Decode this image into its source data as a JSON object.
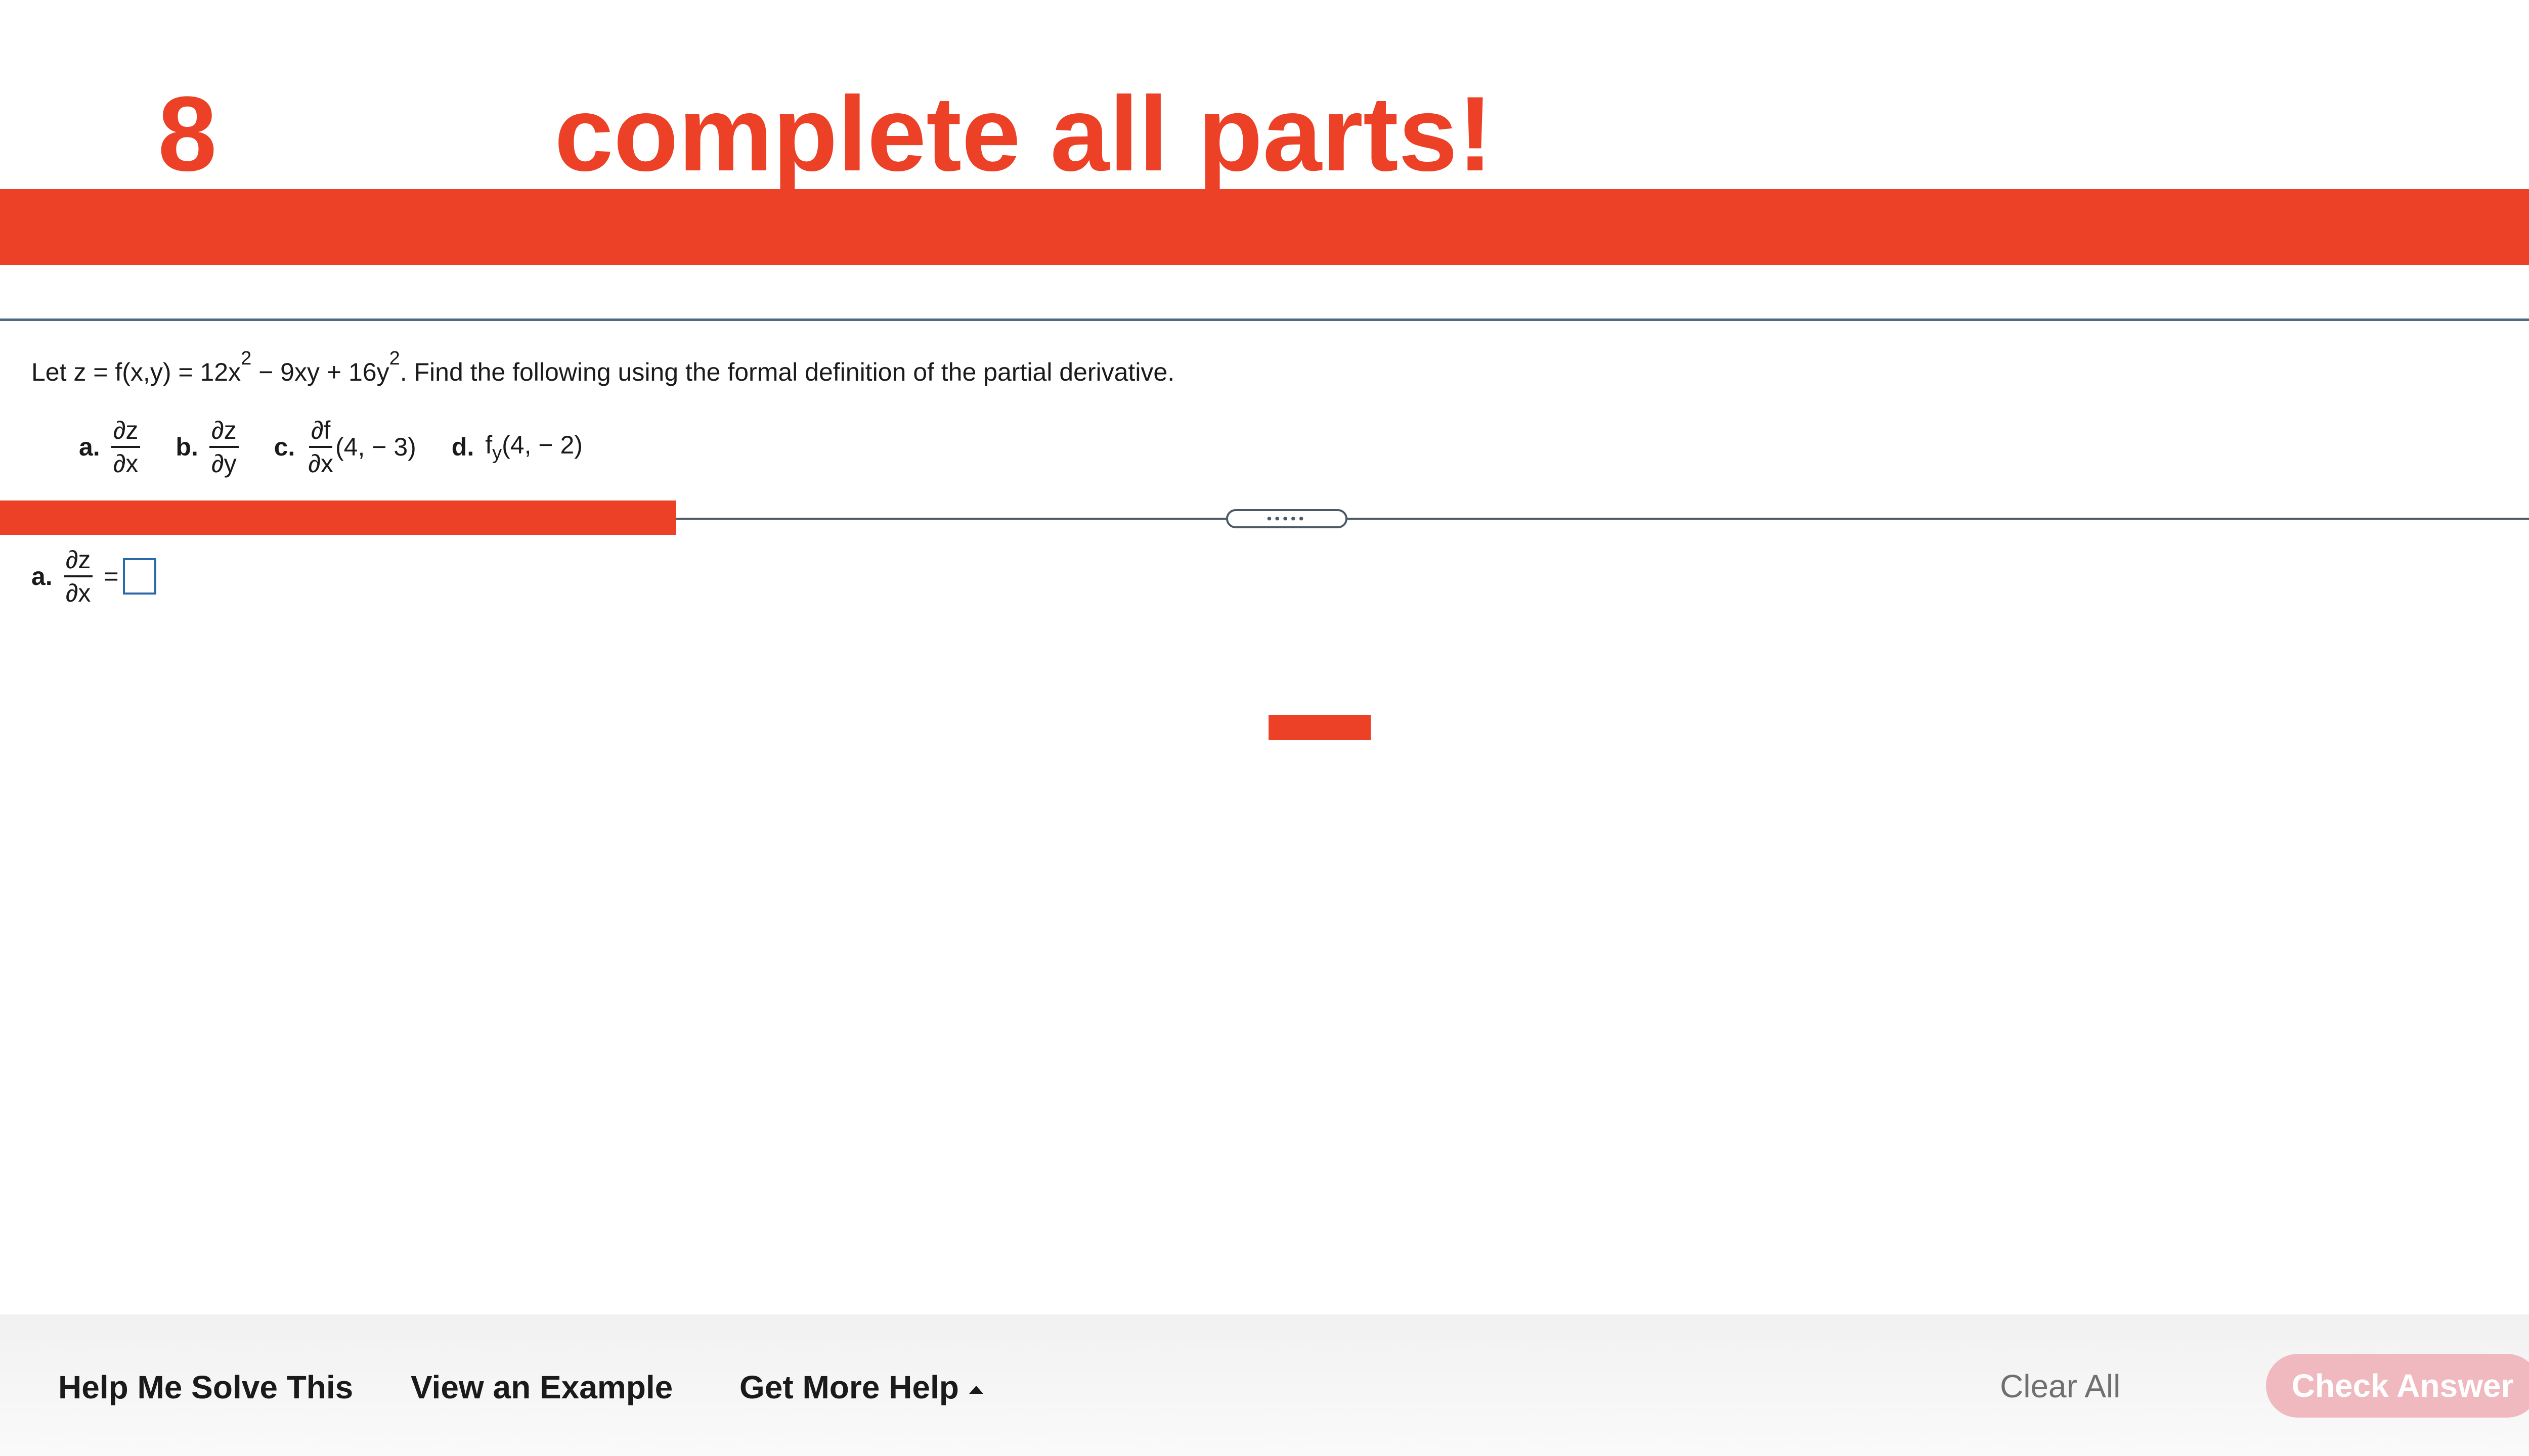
{
  "header": {
    "number": "8",
    "headline": "complete all parts!"
  },
  "question": {
    "intro_prefix": "Let z = f(x,y) = 12x",
    "exp1": "2",
    "mid": " − 9xy + 16y",
    "exp2": "2",
    "suffix": ". Find the following using the formal definition of the partial derivative.",
    "parts": [
      {
        "label": "a.",
        "num": "∂z",
        "den": "∂x",
        "tail": ""
      },
      {
        "label": "b.",
        "num": "∂z",
        "den": "∂y",
        "tail": ""
      },
      {
        "label": "c.",
        "num": "∂f",
        "den": "∂x",
        "tail": "(4, − 3)"
      },
      {
        "label": "d.",
        "text_prefix": "f",
        "sub": "y",
        "tail": "(4, − 2)"
      }
    ]
  },
  "divider": {
    "grip": "•••••"
  },
  "answer": {
    "label": "a.",
    "num": "∂z",
    "den": "∂x",
    "equals": "="
  },
  "footer": {
    "help_me_solve": "Help Me Solve This",
    "view_example": "View an Example",
    "get_more_help": "Get More Help",
    "clear_all": "Clear All",
    "check_answer": "Check Answer"
  },
  "colors": {
    "accent_red": "#ec4126",
    "check_button_disabled": "#f0b8bf",
    "answer_box_border": "#2a6aa8"
  }
}
